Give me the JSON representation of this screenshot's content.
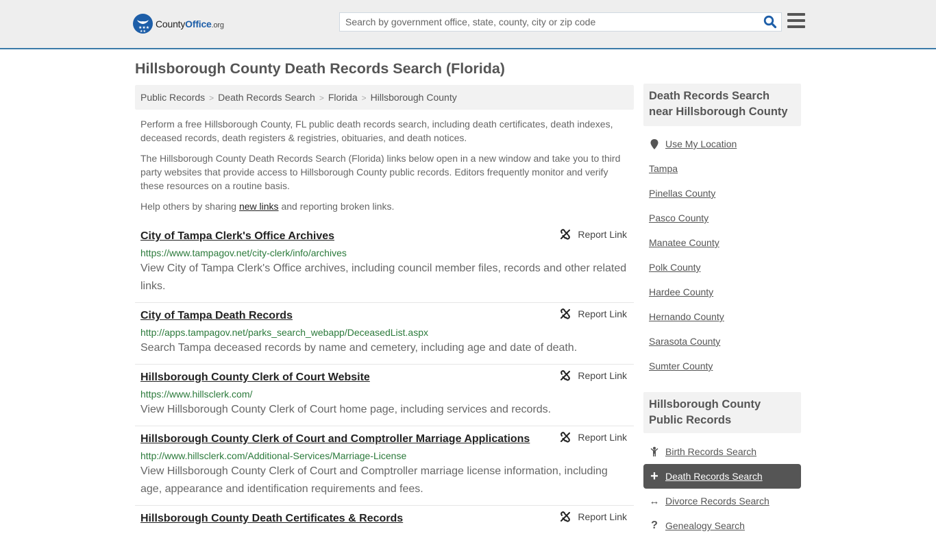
{
  "header": {
    "logo_text_main": "County",
    "logo_text_bold": "Office",
    "logo_text_suffix": ".org",
    "search_placeholder": "Search by government office, state, county, city or zip code",
    "search_value": "",
    "search_icon": "search-icon",
    "menu_icon": "hamburger-menu-icon"
  },
  "page": {
    "title": "Hillsborough County Death Records Search (Florida)"
  },
  "breadcrumb": [
    {
      "label": "Public Records"
    },
    {
      "label": "Death Records Search"
    },
    {
      "label": "Florida"
    },
    {
      "label": "Hillsborough County"
    }
  ],
  "intro": {
    "p1": "Perform a free Hillsborough County, FL public death records search, including death certificates, death indexes, deceased records, death registers & registries, obituaries, and death notices.",
    "p2": "The Hillsborough County Death Records Search (Florida) links below open in a new window and take you to third party websites that provide access to Hillsborough County public records. Editors frequently monitor and verify these resources on a routine basis.",
    "p3_before": "Help others by sharing ",
    "p3_link": "new links",
    "p3_after": " and reporting broken links."
  },
  "report_label": "Report Link",
  "results": [
    {
      "title": "City of Tampa Clerk's Office Archives",
      "url": "https://www.tampagov.net/city-clerk/info/archives",
      "desc": "View City of Tampa Clerk's Office archives, including council member files, records and other related links."
    },
    {
      "title": "City of Tampa Death Records",
      "url": "http://apps.tampagov.net/parks_search_webapp/DeceasedList.aspx",
      "desc": "Search Tampa deceased records by name and cemetery, including age and date of death."
    },
    {
      "title": "Hillsborough County Clerk of Court Website",
      "url": "https://www.hillsclerk.com/",
      "desc": "View Hillsborough County Clerk of Court home page, including services and records."
    },
    {
      "title": "Hillsborough County Clerk of Court and Comptroller Marriage Applications",
      "url": "http://www.hillsclerk.com/Additional-Services/Marriage-License",
      "desc": "View Hillsborough County Clerk of Court and Comptroller marriage license information, including age, appearance and identification requirements and fees."
    },
    {
      "title": "Hillsborough County Death Certificates & Records",
      "url": "",
      "desc": ""
    }
  ],
  "sidebar": {
    "nearby_heading": "Death Records Search near Hillsborough County",
    "use_location": "Use My Location",
    "nearby": [
      {
        "label": "Tampa"
      },
      {
        "label": "Pinellas County"
      },
      {
        "label": "Pasco County"
      },
      {
        "label": "Manatee County"
      },
      {
        "label": "Polk County"
      },
      {
        "label": "Hardee County"
      },
      {
        "label": "Hernando County"
      },
      {
        "label": "Sarasota County"
      },
      {
        "label": "Sumter County"
      }
    ],
    "records_heading": "Hillsborough County Public Records",
    "records": [
      {
        "label": "Birth Records Search",
        "icon": "child-icon",
        "glyph": "",
        "active": false
      },
      {
        "label": "Death Records Search",
        "icon": "plus-icon",
        "glyph": "+",
        "active": true
      },
      {
        "label": "Divorce Records Search",
        "icon": "arrows-horizontal-icon",
        "glyph": "↔",
        "active": false
      },
      {
        "label": "Genealogy Search",
        "icon": "question-icon",
        "glyph": "?",
        "active": false
      }
    ]
  },
  "colors": {
    "brand_blue": "#1d5ea8",
    "header_border": "#3a7aa8",
    "url_green": "#2b7a3b",
    "active_bg": "#555555"
  }
}
